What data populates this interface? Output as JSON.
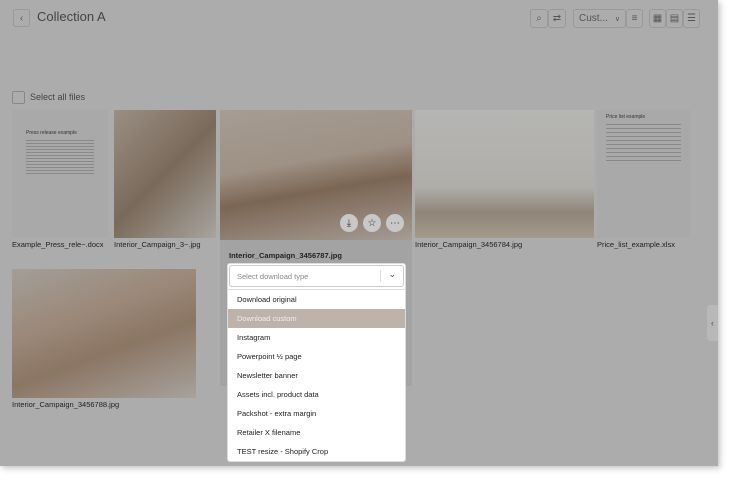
{
  "header": {
    "title": "Collection A",
    "sort_value": "Cust...",
    "icons": [
      "back-icon",
      "search-icon",
      "filter-icon",
      "chevron-down-icon",
      "sort-icon",
      "grid-large-icon",
      "grid-small-icon",
      "list-icon"
    ]
  },
  "select_all": "Select all files",
  "files": [
    {
      "name": "Example_Press_rele~.docx",
      "doc_title": "Press release example"
    },
    {
      "name": "Interior_Campaign_3~.jpg"
    },
    {
      "name": "Interior_Campaign_3456787.jpg"
    },
    {
      "name": "Interior_Campaign_3456784.jpg"
    },
    {
      "name": "Price_list_example.xlsx",
      "doc_title": "Price list example"
    },
    {
      "name": "Interior_Campaign_3456788.jpg"
    }
  ],
  "dropdown": {
    "placeholder": "Select download type",
    "highlighted": "Download custom",
    "options": [
      "Download original",
      "Download custom",
      "Instagram",
      "Powerpoint ½ page",
      "Newsletter banner",
      "Assets incl. product data",
      "Packshot - extra margin",
      "Retailer X filename",
      "TEST resize - Shopify Crop"
    ]
  },
  "colors": {
    "overlay": "#acacac",
    "highlight": "#bdb3aa"
  }
}
